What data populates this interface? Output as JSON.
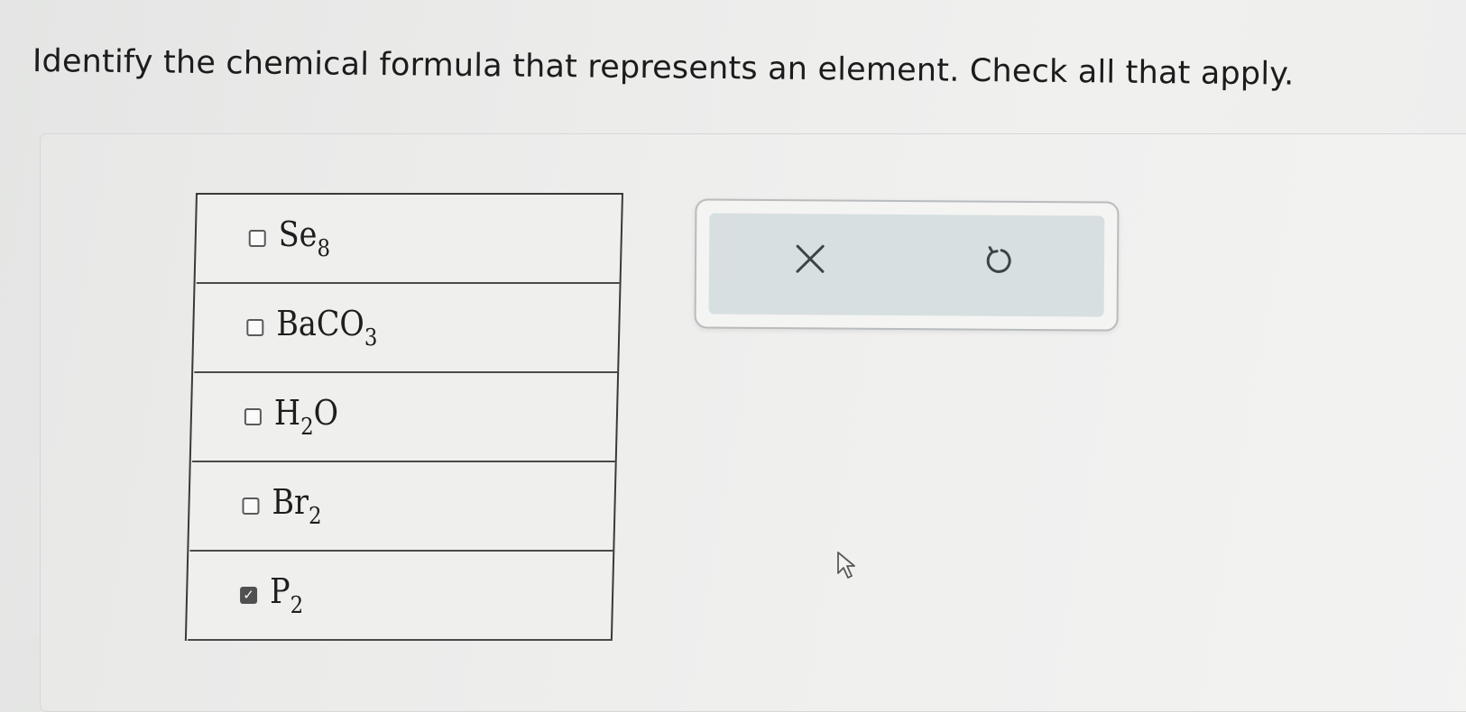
{
  "question": "Identify the chemical formula that represents an element. Check all that apply.",
  "options": [
    {
      "base": "Se",
      "sub": "8",
      "after": "",
      "checked": false
    },
    {
      "base": "BaCO",
      "sub": "3",
      "after": "",
      "checked": false
    },
    {
      "base": "H",
      "sub": "2",
      "after": "O",
      "checked": false
    },
    {
      "base": "Br",
      "sub": "2",
      "after": "",
      "checked": false
    },
    {
      "base": "P",
      "sub": "2",
      "after": "",
      "checked": true
    }
  ],
  "toolbox": {
    "clear_icon": "x-icon",
    "reset_icon": "undo-icon"
  },
  "colors": {
    "checkbox_checked": "#505050",
    "toolbox_fill": "#d7dfe0"
  }
}
